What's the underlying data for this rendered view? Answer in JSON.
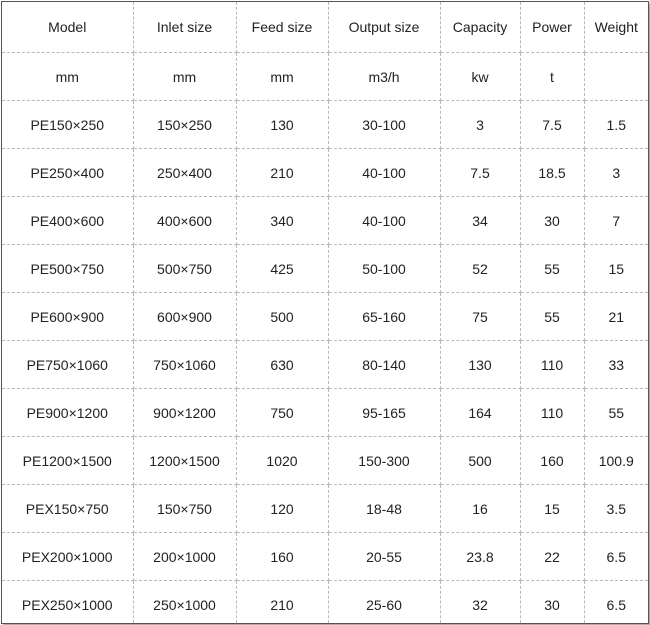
{
  "table": {
    "headers": [
      "Model",
      "Inlet size",
      "Feed size",
      "Output size",
      "Capacity",
      "Power",
      "Weight"
    ],
    "units": [
      "mm",
      "mm",
      "mm",
      "m3/h",
      "kw",
      "t",
      ""
    ],
    "rows": [
      [
        "PE150×250",
        "150×250",
        "130",
        "30-100",
        "3",
        "7.5",
        "1.5"
      ],
      [
        "PE250×400",
        "250×400",
        "210",
        "40-100",
        "7.5",
        "18.5",
        "3"
      ],
      [
        "PE400×600",
        "400×600",
        "340",
        "40-100",
        "34",
        "30",
        "7"
      ],
      [
        "PE500×750",
        "500×750",
        "425",
        "50-100",
        "52",
        "55",
        "15"
      ],
      [
        "PE600×900",
        "600×900",
        "500",
        "65-160",
        "75",
        "55",
        "21"
      ],
      [
        "PE750×1060",
        "750×1060",
        "630",
        "80-140",
        "130",
        "110",
        "33"
      ],
      [
        "PE900×1200",
        "900×1200",
        "750",
        "95-165",
        "164",
        "110",
        "55"
      ],
      [
        "PE1200×1500",
        "1200×1500",
        "1020",
        "150-300",
        "500",
        "160",
        "100.9"
      ],
      [
        "PEX150×750",
        "150×750",
        "120",
        "18-48",
        "16",
        "15",
        "3.5"
      ],
      [
        "PEX200×1000",
        "200×1000",
        "160",
        "20-55",
        "23.8",
        "22",
        "6.5"
      ],
      [
        "PEX250×1000",
        "250×1000",
        "210",
        "25-60",
        "32",
        "30",
        "6.5"
      ]
    ]
  }
}
